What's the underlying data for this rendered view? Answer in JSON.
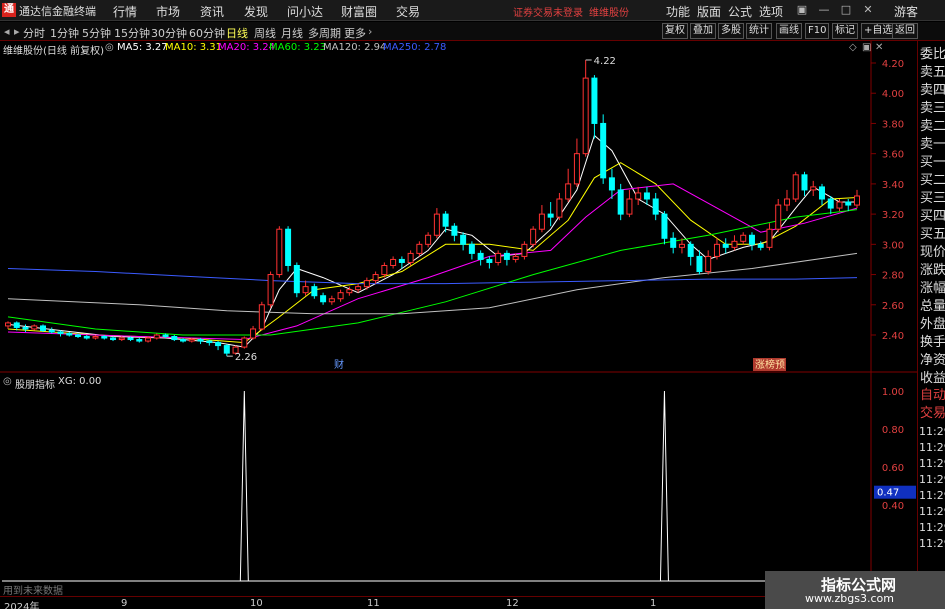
{
  "app": {
    "title": "通达信金融终端",
    "logo_glyph": "通",
    "menu": [
      "行情",
      "市场",
      "资讯",
      "发现",
      "问小达",
      "财富圈",
      "交易"
    ],
    "status_left": "证券交易未登录",
    "status_right": "维维股份",
    "right_menu": [
      "功能",
      "版面",
      "公式",
      "选项"
    ],
    "guest": "游客"
  },
  "period_tabs": [
    "分时",
    "1分钟",
    "5分钟",
    "15分钟",
    "30分钟",
    "60分钟",
    "日线",
    "周线",
    "月线",
    "多周期",
    "更多"
  ],
  "active_period": "日线",
  "toolbar_buttons": [
    "复权",
    "叠加",
    "多股",
    "统计",
    "画线",
    "F10",
    "标记",
    "+自选",
    "返回"
  ],
  "main_legend": {
    "title": "维维股份(日线 前复权)",
    "ma": [
      {
        "label": "MA5: 3.27",
        "color": "#ffffff"
      },
      {
        "label": "MA10: 3.31",
        "color": "#ffff00"
      },
      {
        "label": "MA20: 3.24",
        "color": "#ff00ff"
      },
      {
        "label": "MA60: 3.23",
        "color": "#00ff00"
      },
      {
        "label": "MA120: 2.94",
        "color": "#c0c0c0"
      },
      {
        "label": "MA250: 2.78",
        "color": "#3b5bff"
      }
    ]
  },
  "price_axis": [
    "4.20",
    "4.00",
    "3.80",
    "3.60",
    "3.40",
    "3.20",
    "3.00",
    "2.80",
    "2.60",
    "2.40"
  ],
  "indicator_axis": [
    "1.00",
    "0.80",
    "0.60",
    "0.40"
  ],
  "indicator_value_badge": "0.47",
  "annotations": {
    "high": "4.22",
    "low": "2.26",
    "cai": "财",
    "badge": "涨榜预"
  },
  "sub_legend": {
    "title": "股朋指标",
    "value": "XG: 0.00"
  },
  "future_text": "用到未来数据",
  "date_labels": [
    "2024年",
    "9",
    "10",
    "11",
    "12",
    "1"
  ],
  "right_panel": {
    "rows": [
      "委比",
      "卖五",
      "卖四",
      "卖三",
      "卖二",
      "卖一",
      "买一",
      "买二",
      "买三",
      "买四",
      "买五",
      "现价",
      "涨跌",
      "涨幅",
      "总量",
      "外盘",
      "换手",
      "净资",
      "收益"
    ],
    "sub_rows": [
      "自动",
      "交易"
    ],
    "times": [
      "11:29",
      "11:29",
      "11:29",
      "11:29",
      "11:29",
      "11:29",
      "11:29",
      "11:29"
    ]
  },
  "watermark": {
    "title": "指标公式网",
    "url": "www.zbgs3.com"
  },
  "chart_data": {
    "type": "candlestick",
    "title": "维维股份(日线 前复权)",
    "y_range": [
      2.2,
      4.3
    ],
    "high": 4.22,
    "low": 2.26,
    "candles": [
      [
        2.46,
        2.48,
        2.44,
        2.49
      ],
      [
        2.48,
        2.45,
        2.43,
        2.49
      ],
      [
        2.45,
        2.44,
        2.42,
        2.47
      ],
      [
        2.44,
        2.46,
        2.43,
        2.47
      ],
      [
        2.46,
        2.43,
        2.42,
        2.47
      ],
      [
        2.43,
        2.42,
        2.41,
        2.45
      ],
      [
        2.42,
        2.41,
        2.39,
        2.43
      ],
      [
        2.41,
        2.4,
        2.39,
        2.42
      ],
      [
        2.4,
        2.39,
        2.38,
        2.41
      ],
      [
        2.39,
        2.38,
        2.37,
        2.4
      ],
      [
        2.38,
        2.39,
        2.37,
        2.4
      ],
      [
        2.39,
        2.38,
        2.37,
        2.4
      ],
      [
        2.38,
        2.37,
        2.36,
        2.39
      ],
      [
        2.37,
        2.38,
        2.36,
        2.39
      ],
      [
        2.38,
        2.37,
        2.36,
        2.39
      ],
      [
        2.37,
        2.36,
        2.35,
        2.38
      ],
      [
        2.36,
        2.38,
        2.35,
        2.39
      ],
      [
        2.38,
        2.4,
        2.37,
        2.41
      ],
      [
        2.4,
        2.39,
        2.38,
        2.41
      ],
      [
        2.39,
        2.37,
        2.36,
        2.4
      ],
      [
        2.37,
        2.36,
        2.35,
        2.38
      ],
      [
        2.36,
        2.37,
        2.35,
        2.38
      ],
      [
        2.37,
        2.36,
        2.34,
        2.38
      ],
      [
        2.36,
        2.35,
        2.33,
        2.37
      ],
      [
        2.35,
        2.33,
        2.3,
        2.36
      ],
      [
        2.33,
        2.28,
        2.26,
        2.34
      ],
      [
        2.28,
        2.32,
        2.27,
        2.33
      ],
      [
        2.32,
        2.38,
        2.31,
        2.39
      ],
      [
        2.38,
        2.44,
        2.37,
        2.46
      ],
      [
        2.44,
        2.6,
        2.43,
        2.62
      ],
      [
        2.6,
        2.8,
        2.58,
        2.82
      ],
      [
        2.8,
        3.1,
        2.78,
        3.12
      ],
      [
        3.1,
        2.86,
        2.82,
        3.12
      ],
      [
        2.86,
        2.68,
        2.65,
        2.88
      ],
      [
        2.68,
        2.72,
        2.66,
        2.76
      ],
      [
        2.72,
        2.66,
        2.64,
        2.74
      ],
      [
        2.66,
        2.62,
        2.6,
        2.68
      ],
      [
        2.62,
        2.64,
        2.6,
        2.66
      ],
      [
        2.64,
        2.68,
        2.62,
        2.7
      ],
      [
        2.68,
        2.7,
        2.66,
        2.72
      ],
      [
        2.7,
        2.72,
        2.68,
        2.74
      ],
      [
        2.72,
        2.76,
        2.7,
        2.78
      ],
      [
        2.76,
        2.8,
        2.74,
        2.82
      ],
      [
        2.8,
        2.86,
        2.78,
        2.88
      ],
      [
        2.86,
        2.9,
        2.84,
        2.92
      ],
      [
        2.9,
        2.88,
        2.84,
        2.92
      ],
      [
        2.88,
        2.94,
        2.86,
        2.96
      ],
      [
        2.94,
        3.0,
        2.92,
        3.02
      ],
      [
        3.0,
        3.06,
        2.98,
        3.08
      ],
      [
        3.06,
        3.2,
        3.04,
        3.24
      ],
      [
        3.2,
        3.12,
        3.08,
        3.22
      ],
      [
        3.12,
        3.06,
        3.02,
        3.14
      ],
      [
        3.06,
        3.0,
        2.96,
        3.08
      ],
      [
        3.0,
        2.94,
        2.9,
        3.02
      ],
      [
        2.94,
        2.9,
        2.86,
        2.96
      ],
      [
        2.9,
        2.88,
        2.84,
        2.92
      ],
      [
        2.88,
        2.94,
        2.86,
        2.96
      ],
      [
        2.94,
        2.9,
        2.86,
        2.96
      ],
      [
        2.9,
        2.92,
        2.88,
        2.94
      ],
      [
        2.92,
        3.0,
        2.9,
        3.02
      ],
      [
        3.0,
        3.1,
        2.98,
        3.12
      ],
      [
        3.1,
        3.2,
        3.08,
        3.26
      ],
      [
        3.2,
        3.18,
        3.12,
        3.28
      ],
      [
        3.18,
        3.3,
        3.16,
        3.34
      ],
      [
        3.3,
        3.4,
        3.28,
        3.5
      ],
      [
        3.4,
        3.6,
        3.38,
        3.7
      ],
      [
        3.6,
        4.1,
        3.58,
        4.22
      ],
      [
        4.1,
        3.8,
        3.7,
        4.12
      ],
      [
        3.8,
        3.44,
        3.4,
        3.86
      ],
      [
        3.44,
        3.36,
        3.3,
        3.5
      ],
      [
        3.36,
        3.2,
        3.16,
        3.4
      ],
      [
        3.2,
        3.3,
        3.18,
        3.36
      ],
      [
        3.3,
        3.34,
        3.26,
        3.38
      ],
      [
        3.34,
        3.3,
        3.26,
        3.38
      ],
      [
        3.3,
        3.2,
        3.16,
        3.34
      ],
      [
        3.2,
        3.04,
        3.0,
        3.22
      ],
      [
        3.04,
        2.98,
        2.94,
        3.08
      ],
      [
        2.98,
        3.0,
        2.94,
        3.04
      ],
      [
        3.0,
        2.92,
        2.86,
        3.02
      ],
      [
        2.92,
        2.82,
        2.8,
        2.96
      ],
      [
        2.82,
        2.92,
        2.8,
        2.96
      ],
      [
        2.92,
        3.0,
        2.9,
        3.04
      ],
      [
        3.0,
        2.98,
        2.94,
        3.04
      ],
      [
        2.98,
        3.02,
        2.96,
        3.06
      ],
      [
        3.02,
        3.06,
        3.0,
        3.08
      ],
      [
        3.06,
        3.0,
        2.96,
        3.08
      ],
      [
        3.0,
        2.98,
        2.96,
        3.02
      ],
      [
        2.98,
        3.1,
        2.96,
        3.14
      ],
      [
        3.1,
        3.26,
        3.08,
        3.3
      ],
      [
        3.26,
        3.3,
        3.22,
        3.36
      ],
      [
        3.3,
        3.46,
        3.28,
        3.48
      ],
      [
        3.46,
        3.36,
        3.32,
        3.48
      ],
      [
        3.36,
        3.38,
        3.32,
        3.42
      ],
      [
        3.38,
        3.3,
        3.26,
        3.4
      ],
      [
        3.3,
        3.24,
        3.2,
        3.32
      ],
      [
        3.24,
        3.28,
        3.22,
        3.3
      ],
      [
        3.28,
        3.26,
        3.22,
        3.3
      ],
      [
        3.26,
        3.32,
        3.24,
        3.36
      ]
    ],
    "ma_lines": [
      {
        "name": "MA5",
        "color": "#ffffff",
        "values": [
          [
            0,
            2.47
          ],
          [
            6,
            2.43
          ],
          [
            12,
            2.39
          ],
          [
            18,
            2.38
          ],
          [
            24,
            2.35
          ],
          [
            27,
            2.32
          ],
          [
            29,
            2.44
          ],
          [
            31,
            2.7
          ],
          [
            33,
            2.84
          ],
          [
            36,
            2.78
          ],
          [
            40,
            2.68
          ],
          [
            44,
            2.8
          ],
          [
            48,
            2.96
          ],
          [
            50,
            3.1
          ],
          [
            53,
            3.06
          ],
          [
            56,
            2.92
          ],
          [
            59,
            2.94
          ],
          [
            62,
            3.1
          ],
          [
            65,
            3.36
          ],
          [
            67,
            3.72
          ],
          [
            69,
            3.62
          ],
          [
            72,
            3.3
          ],
          [
            75,
            3.2
          ],
          [
            78,
            3.0
          ],
          [
            80,
            2.9
          ],
          [
            84,
            2.98
          ],
          [
            87,
            3.02
          ],
          [
            90,
            3.24
          ],
          [
            92,
            3.38
          ],
          [
            95,
            3.28
          ],
          [
            97,
            3.28
          ]
        ]
      },
      {
        "name": "MA10",
        "color": "#ffff00",
        "values": [
          [
            0,
            2.44
          ],
          [
            10,
            2.4
          ],
          [
            20,
            2.38
          ],
          [
            27,
            2.35
          ],
          [
            31,
            2.52
          ],
          [
            35,
            2.7
          ],
          [
            40,
            2.74
          ],
          [
            45,
            2.82
          ],
          [
            50,
            3.0
          ],
          [
            55,
            3.0
          ],
          [
            60,
            2.96
          ],
          [
            64,
            3.16
          ],
          [
            67,
            3.44
          ],
          [
            70,
            3.54
          ],
          [
            74,
            3.4
          ],
          [
            78,
            3.16
          ],
          [
            82,
            3.0
          ],
          [
            86,
            3.0
          ],
          [
            90,
            3.12
          ],
          [
            94,
            3.3
          ],
          [
            97,
            3.31
          ]
        ]
      },
      {
        "name": "MA20",
        "color": "#ff00ff",
        "values": [
          [
            0,
            2.42
          ],
          [
            15,
            2.39
          ],
          [
            27,
            2.37
          ],
          [
            33,
            2.46
          ],
          [
            40,
            2.64
          ],
          [
            48,
            2.78
          ],
          [
            55,
            2.92
          ],
          [
            62,
            2.96
          ],
          [
            66,
            3.18
          ],
          [
            70,
            3.36
          ],
          [
            76,
            3.4
          ],
          [
            81,
            3.24
          ],
          [
            86,
            3.08
          ],
          [
            91,
            3.14
          ],
          [
            97,
            3.24
          ]
        ]
      },
      {
        "name": "MA60",
        "color": "#00ff00",
        "values": [
          [
            0,
            2.52
          ],
          [
            10,
            2.44
          ],
          [
            20,
            2.4
          ],
          [
            30,
            2.4
          ],
          [
            40,
            2.48
          ],
          [
            50,
            2.62
          ],
          [
            60,
            2.8
          ],
          [
            70,
            2.96
          ],
          [
            80,
            3.06
          ],
          [
            90,
            3.18
          ],
          [
            97,
            3.23
          ]
        ]
      },
      {
        "name": "MA120",
        "color": "#c0c0c0",
        "values": [
          [
            0,
            2.64
          ],
          [
            15,
            2.6
          ],
          [
            25,
            2.56
          ],
          [
            35,
            2.54
          ],
          [
            45,
            2.54
          ],
          [
            55,
            2.58
          ],
          [
            65,
            2.7
          ],
          [
            75,
            2.78
          ],
          [
            85,
            2.84
          ],
          [
            97,
            2.94
          ]
        ]
      },
      {
        "name": "MA250",
        "color": "#3b5bff",
        "values": [
          [
            0,
            2.84
          ],
          [
            10,
            2.82
          ],
          [
            20,
            2.79
          ],
          [
            30,
            2.76
          ],
          [
            40,
            2.74
          ],
          [
            50,
            2.74
          ],
          [
            60,
            2.75
          ],
          [
            70,
            2.76
          ],
          [
            80,
            2.77
          ],
          [
            90,
            2.77
          ],
          [
            97,
            2.78
          ]
        ]
      }
    ],
    "indicator": {
      "name": "XG",
      "y_range": [
        0,
        1
      ],
      "spikes_at": [
        27,
        75
      ]
    }
  }
}
